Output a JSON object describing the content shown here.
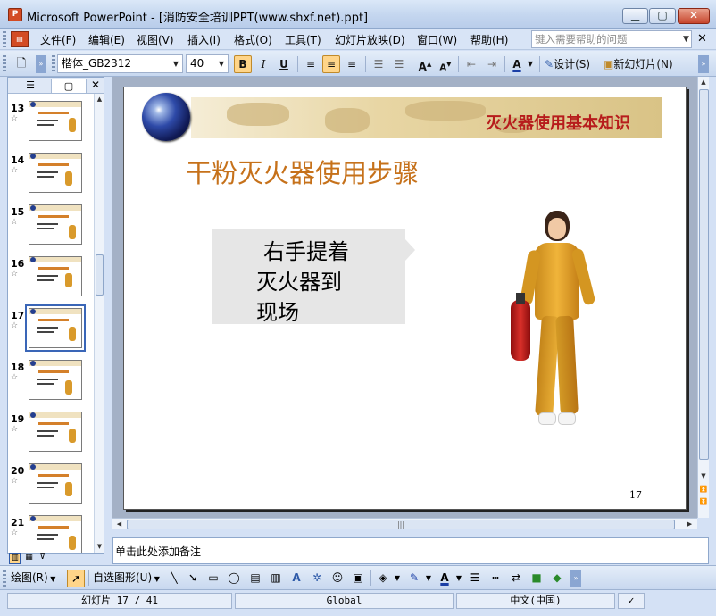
{
  "window": {
    "title": "Microsoft PowerPoint - [消防安全培训PPT(www.shxf.net).ppt]",
    "app_icon_label": "P"
  },
  "menu": {
    "items": [
      "文件(F)",
      "编辑(E)",
      "视图(V)",
      "插入(I)",
      "格式(O)",
      "工具(T)",
      "幻灯片放映(D)",
      "窗口(W)",
      "帮助(H)"
    ],
    "help_search_placeholder": "键入需要帮助的问题"
  },
  "toolbar": {
    "font_name": "楷体_GB2312",
    "font_size": "40",
    "bold": "B",
    "italic": "I",
    "underline": "U",
    "design_label": "设计(S)",
    "new_slide_label": "新幻灯片(N)"
  },
  "slides_pane": {
    "thumbnails": [
      {
        "number": "13"
      },
      {
        "number": "14"
      },
      {
        "number": "15"
      },
      {
        "number": "16"
      },
      {
        "number": "17",
        "selected": true
      },
      {
        "number": "18"
      },
      {
        "number": "19"
      },
      {
        "number": "20"
      },
      {
        "number": "21"
      }
    ]
  },
  "slide": {
    "banner_title": "灭火器使用基本知识",
    "title": "干粉灭火器使用步骤",
    "callout_lines": [
      "右手提着",
      "灭火器到",
      "现场"
    ],
    "page_number": "17"
  },
  "notes": {
    "placeholder": "单击此处添加备注"
  },
  "drawing_toolbar": {
    "draw_label": "绘图(R)",
    "autoshapes_label": "自选图形(U)"
  },
  "status": {
    "slide_indicator": "幻灯片 17 / 41",
    "design_name": "Global",
    "language": "中文(中国)"
  },
  "colors": {
    "title_orange": "#c6711a",
    "banner_red": "#b71c1c",
    "selection_blue": "#3a66b7"
  }
}
